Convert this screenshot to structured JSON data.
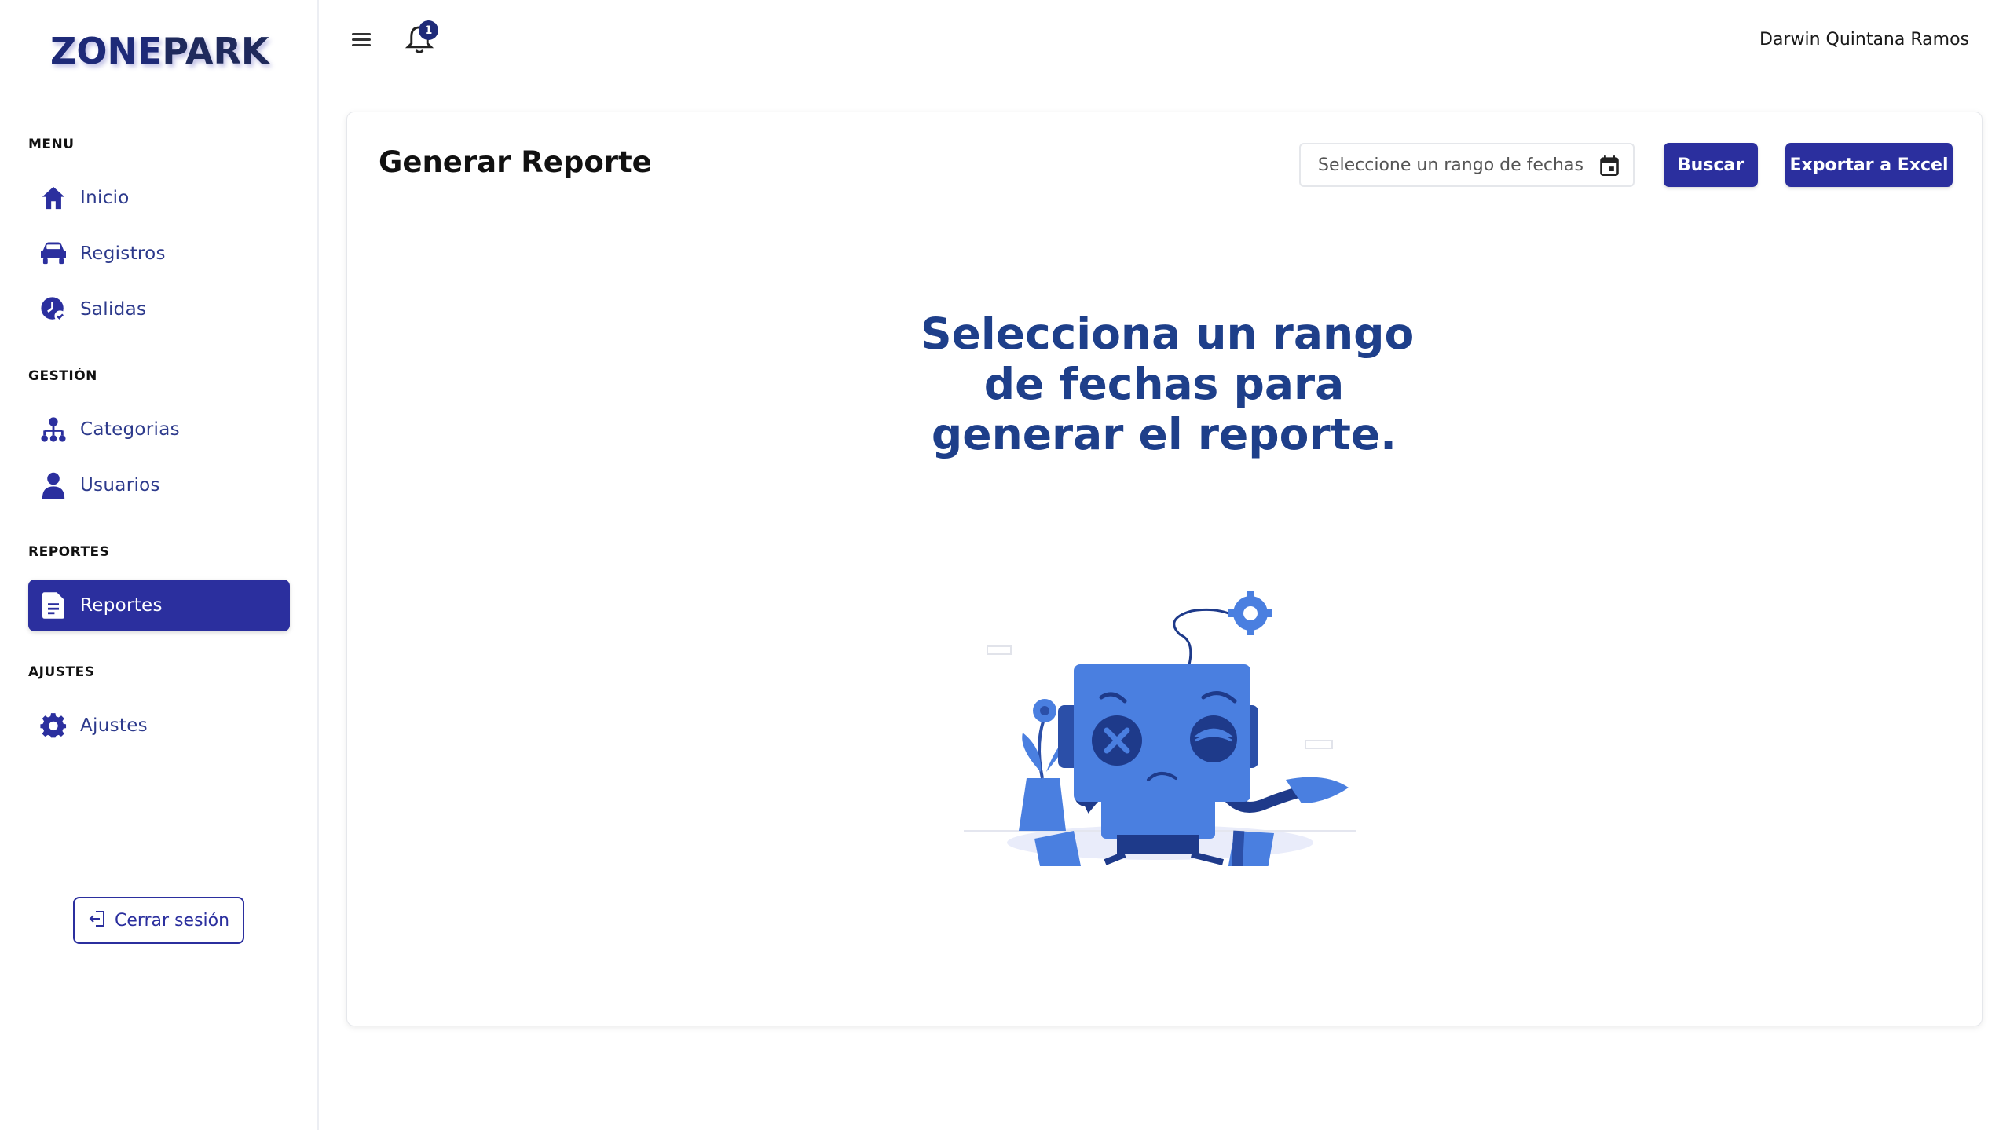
{
  "brand": {
    "logo_part1": "ZONE",
    "logo_part2": "PARK"
  },
  "sidebar": {
    "sections": [
      {
        "label": "MENU"
      },
      {
        "label": "GESTIÓN"
      },
      {
        "label": "REPORTES"
      },
      {
        "label": "AJUSTES"
      }
    ],
    "items": [
      {
        "label": "Inicio",
        "icon": "home-icon"
      },
      {
        "label": "Registros",
        "icon": "car-icon"
      },
      {
        "label": "Salidas",
        "icon": "clock-check-icon"
      },
      {
        "label": "Categorias",
        "icon": "hierarchy-icon"
      },
      {
        "label": "Usuarios",
        "icon": "user-icon"
      },
      {
        "label": "Reportes",
        "icon": "document-icon",
        "active": true
      },
      {
        "label": "Ajustes",
        "icon": "gear-icon"
      }
    ],
    "logout_label": "Cerrar sesión"
  },
  "topbar": {
    "notification_count": "1",
    "user_name": "Darwin Quintana Ramos"
  },
  "card": {
    "title": "Generar Reporte",
    "date_placeholder": "Seleccione un rango de fechas",
    "search_label": "Buscar",
    "export_label": "Exportar a Excel",
    "empty_lines": [
      "Selecciona un rango",
      "de fechas para",
      "generar el reporte."
    ]
  },
  "colors": {
    "primary": "#2b2f9e",
    "brand_text": "#1e2a78",
    "message": "#1e3f8a",
    "robot_blue": "#4a7fe0"
  }
}
